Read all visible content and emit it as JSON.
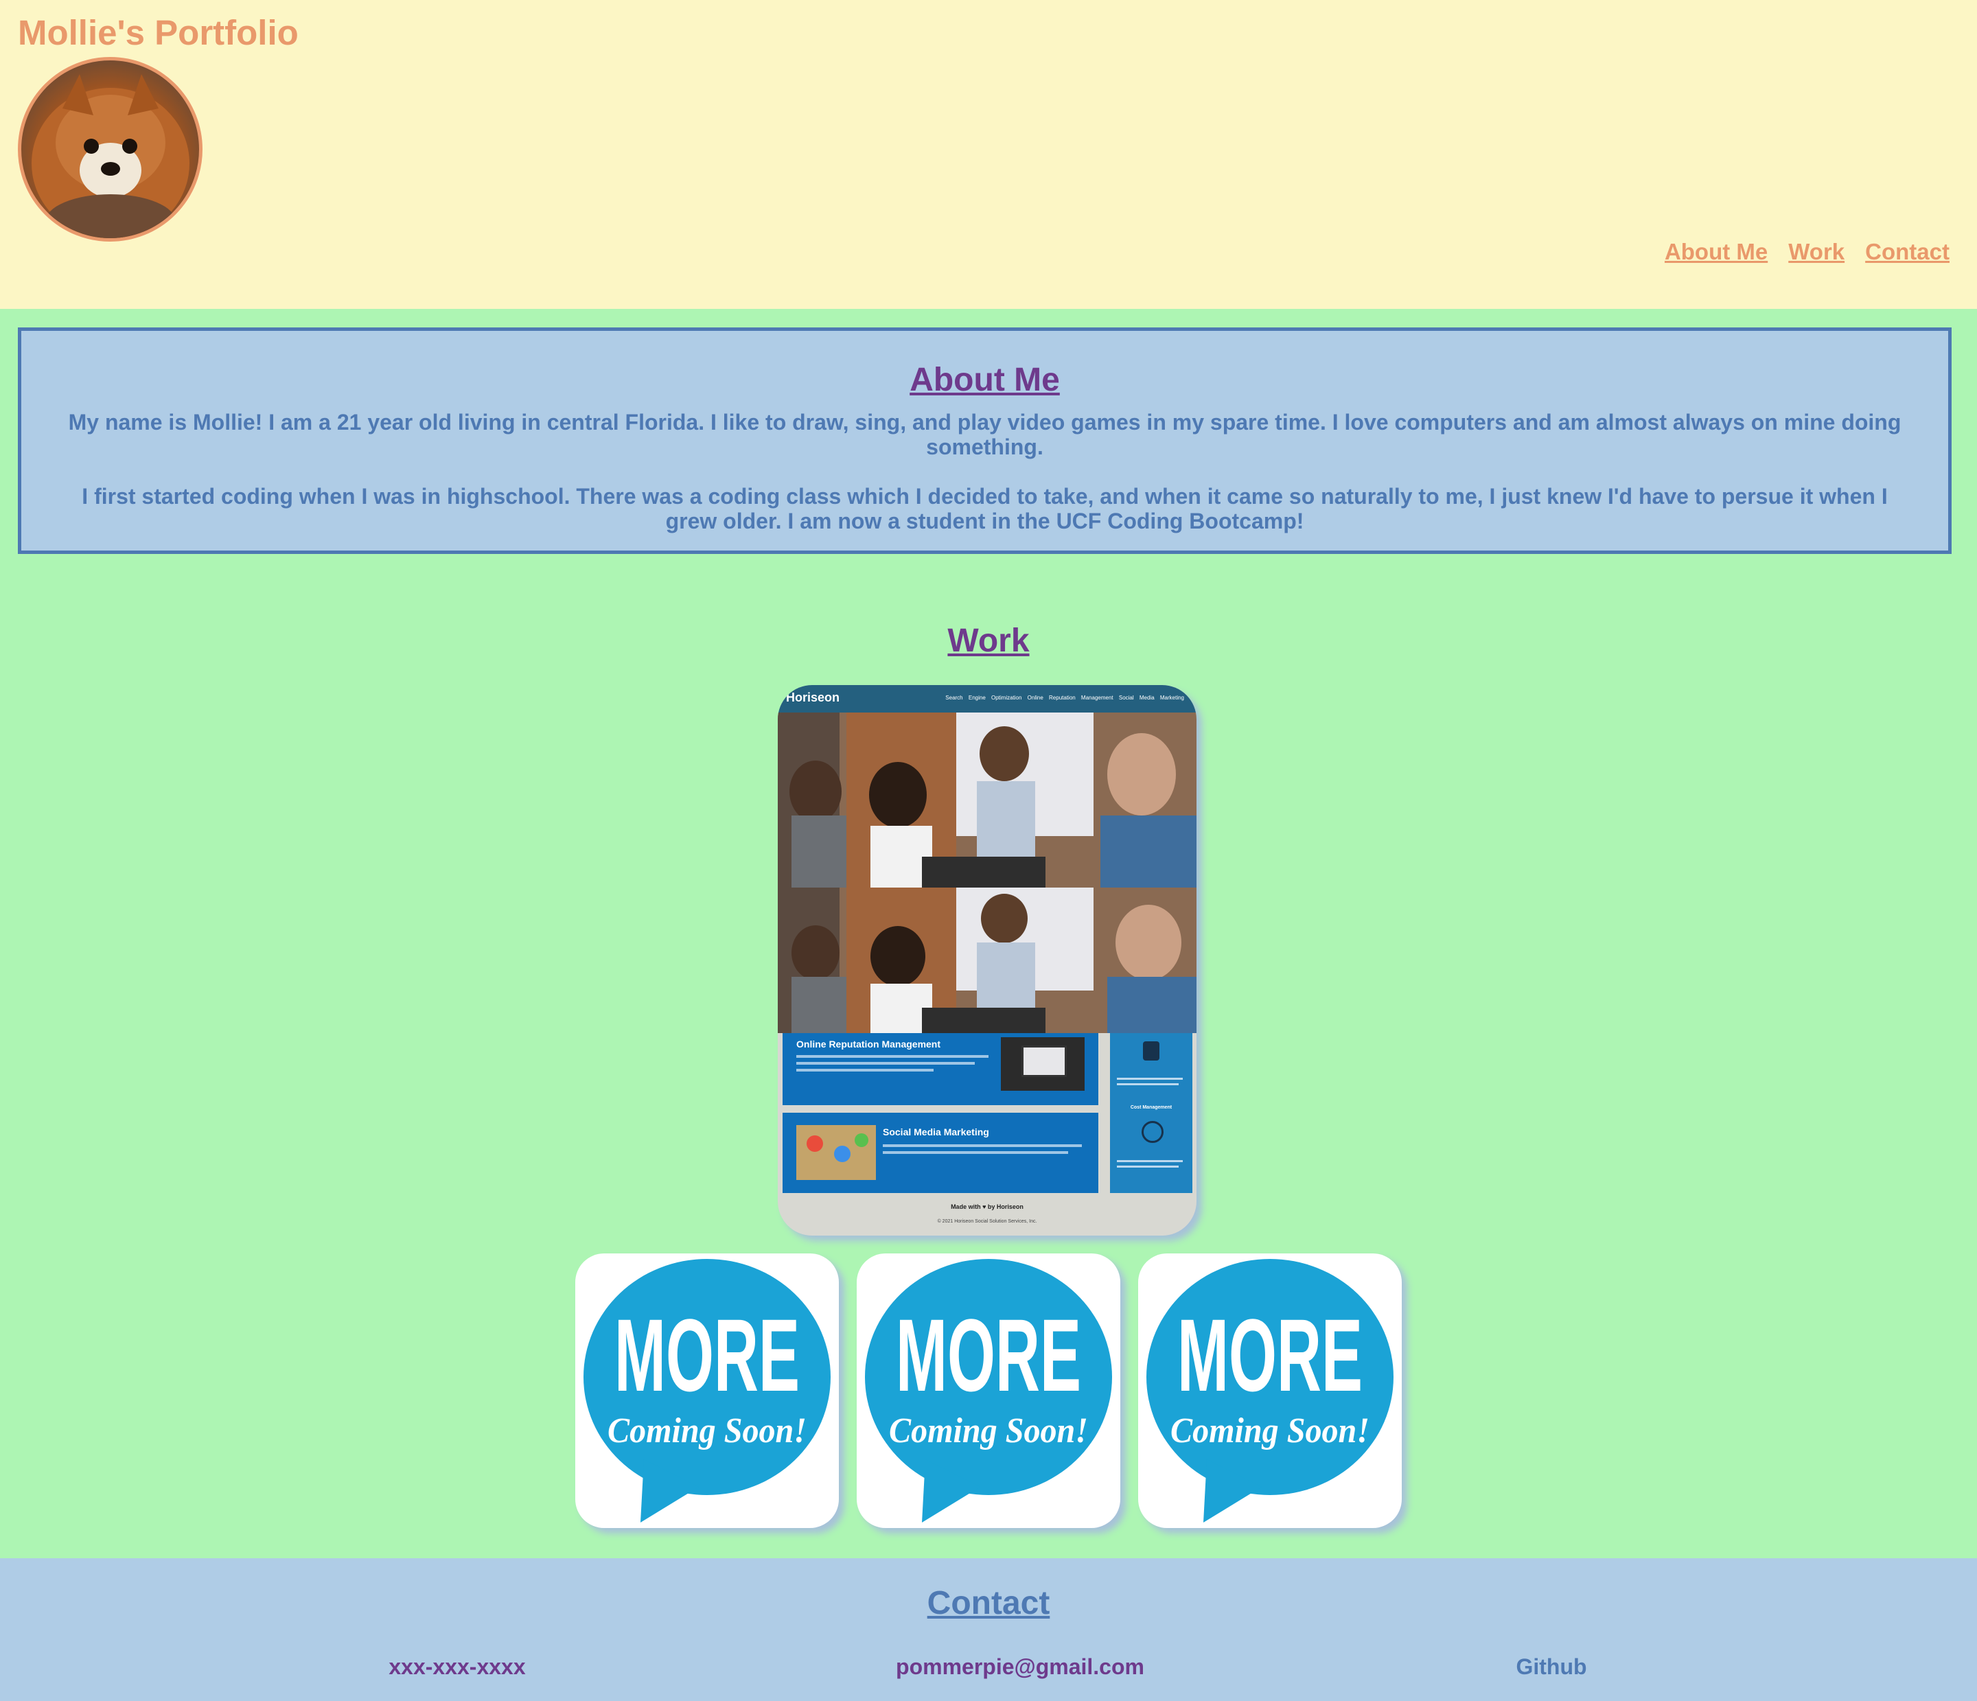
{
  "header": {
    "site_title": "Mollie's Portfolio",
    "nav": [
      "About Me",
      "Work",
      "Contact"
    ]
  },
  "about": {
    "heading": "About Me",
    "paragraphs": [
      "My name is Mollie! I am a 21 year old living in central Florida. I like to draw, sing, and play video games in my spare time. I love computers and am almost always on mine doing something.",
      "I first started coding when I was in highschool. There was a coding class which I decided to take, and when it came so naturally to me, I just knew I'd have to persue it when I grew older. I am now a student in the UCF Coding Bootcamp!"
    ]
  },
  "work": {
    "heading": "Work",
    "project": {
      "brand": "Horiseon",
      "nav": "Search Engine Optimization  Online Reputation Management  Social Media Marketing",
      "card1_title": "Online Reputation Management",
      "card2_title": "Social Media Marketing",
      "aside_heading": "Cost Management",
      "footer": "Made with ♥ by Horiseon",
      "copyright": "© 2021 Horiseon Social Solution Services, Inc."
    },
    "placeholder_cards": [
      {
        "line1": "MORE",
        "line2": "Coming Soon!"
      },
      {
        "line1": "MORE",
        "line2": "Coming Soon!"
      },
      {
        "line1": "MORE",
        "line2": "Coming Soon!"
      }
    ]
  },
  "contact": {
    "heading": "Contact",
    "phone": "xxx-xxx-xxxx",
    "email": "pommerpie@gmail.com",
    "github": "Github"
  },
  "colors": {
    "header_bg": "#fcf6c5",
    "page_bg": "#adf5b3",
    "accent_orange": "#e9996b",
    "panel_blue": "#afcce6",
    "border_blue": "#4e79b3",
    "heading_purple": "#6e3a8c",
    "bubble_blue": "#1ba3d6"
  },
  "icons": [
    "dog-avatar-photo",
    "speech-bubble-icon"
  ]
}
